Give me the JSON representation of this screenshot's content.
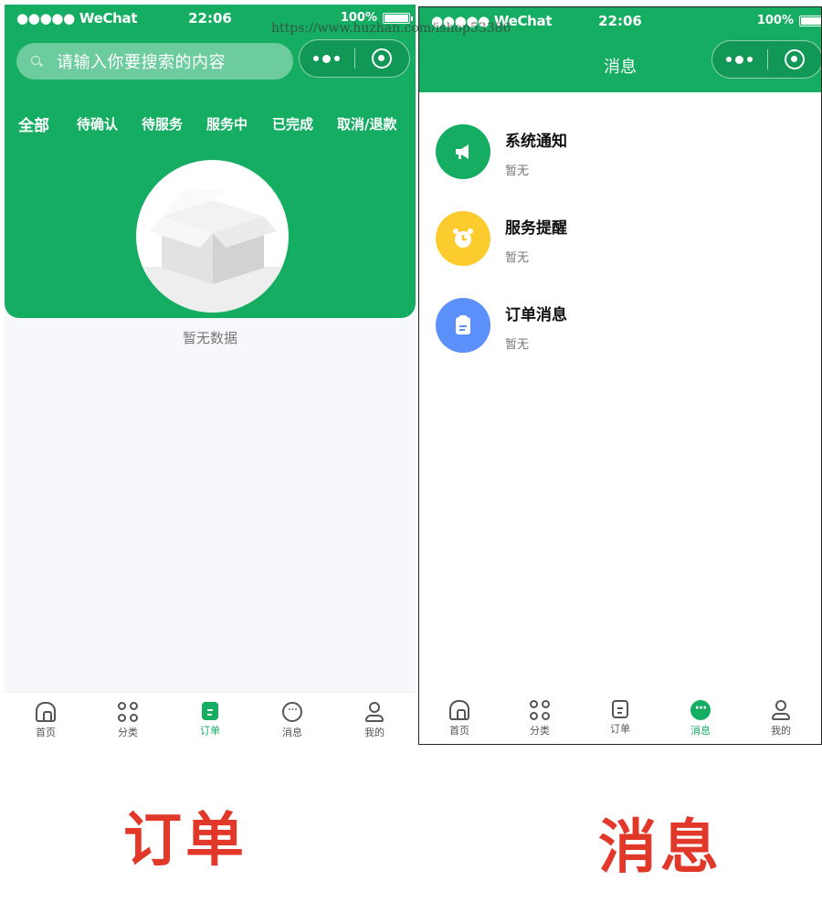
{
  "status_bar": {
    "carrier": "●●●●● WeChat",
    "time": "22:06",
    "battery": "100%"
  },
  "watermark": "https://www.huzhan.com/ishop53386",
  "order_screen": {
    "search_placeholder": "请输入你要搜索的内容",
    "tabs": [
      {
        "label": "全部",
        "active": true
      },
      {
        "label": "待确认"
      },
      {
        "label": "待服务"
      },
      {
        "label": "服务中"
      },
      {
        "label": "已完成"
      },
      {
        "label": "取消/退款"
      }
    ],
    "empty_text": "暂无数据"
  },
  "message_screen": {
    "title": "消息",
    "items": [
      {
        "title": "系统通知",
        "subtitle": "暂无",
        "icon": "megaphone-icon",
        "color": "#14ad62"
      },
      {
        "title": "服务提醒",
        "subtitle": "暂无",
        "icon": "alarm-clock-icon",
        "color": "#fccb2e"
      },
      {
        "title": "订单消息",
        "subtitle": "暂无",
        "icon": "clipboard-icon",
        "color": "#5b8ff9"
      }
    ]
  },
  "tabbar": [
    "首页",
    "分类",
    "订单",
    "消息",
    "我的"
  ],
  "colors": {
    "brand_green": "#14ad62",
    "caption_red": "#e2382a"
  },
  "captions": {
    "left": "订单",
    "right": "消息"
  }
}
